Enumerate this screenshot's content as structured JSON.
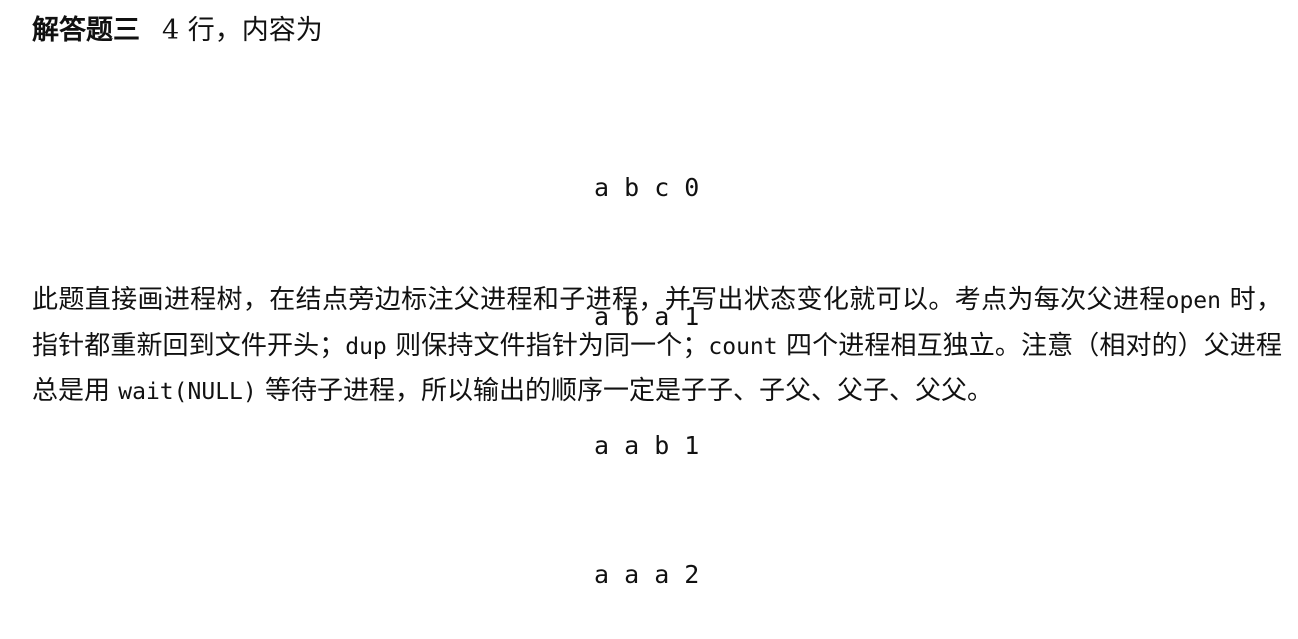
{
  "heading": {
    "label": "解答题三",
    "text": "4 行，内容为"
  },
  "output_lines": [
    "a b c 0",
    "a b a 1",
    "a a b 1",
    "a a a 2"
  ],
  "explanation": {
    "part1": "此题直接画进程树，在结点旁边标注父进程和子进程，并写出状态变化就可以。考点为每次父进程",
    "code1": "open",
    "part2": " 时，指针都重新回到文件开头；",
    "code2": "dup",
    "part3": " 则保持文件指针为同一个；",
    "code3": "count",
    "part4": " 四个进程相互独立。注意（相对的）父进程总是用 ",
    "code4": "wait(NULL)",
    "part5": " 等待子进程，所以输出的顺序一定是子子、子父、父子、父父。"
  }
}
